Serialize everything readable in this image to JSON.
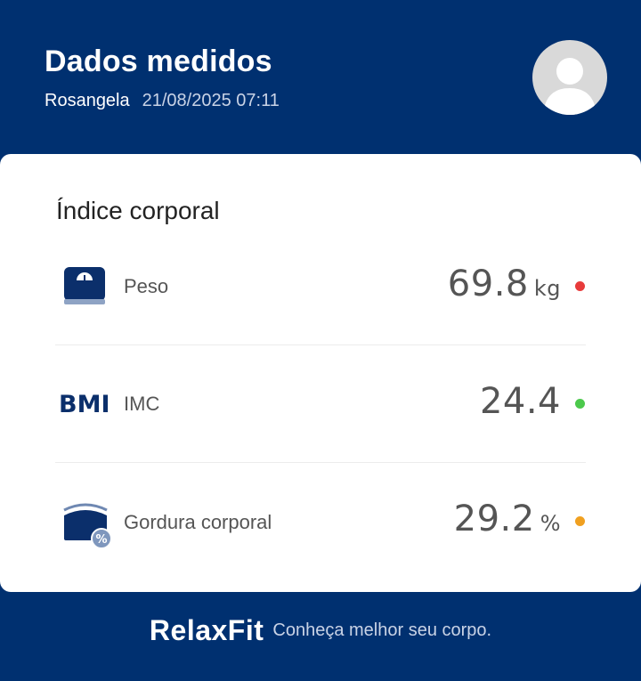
{
  "header": {
    "title": "Dados medidos",
    "user_name": "Rosangela",
    "datetime": "21/08/2025 07:11"
  },
  "card": {
    "title": "Índice corporal",
    "metrics": [
      {
        "label": "Peso",
        "value": "69.8",
        "unit": "kg",
        "status_color": "#e83b3b",
        "icon": "scale-icon"
      },
      {
        "label": "IMC",
        "value": "24.4",
        "unit": "",
        "icon_text": "BMI",
        "status_color": "#4cc94c",
        "icon": "bmi-icon"
      },
      {
        "label": "Gordura corporal",
        "value": "29.2",
        "unit": "%",
        "status_color": "#f0a020",
        "icon": "body-fat-icon"
      }
    ]
  },
  "footer": {
    "brand": "RelaxFit",
    "tagline": "Conheça melhor seu corpo."
  },
  "colors": {
    "background": "#003070",
    "card": "#ffffff",
    "icon": "#0b2f6b"
  }
}
